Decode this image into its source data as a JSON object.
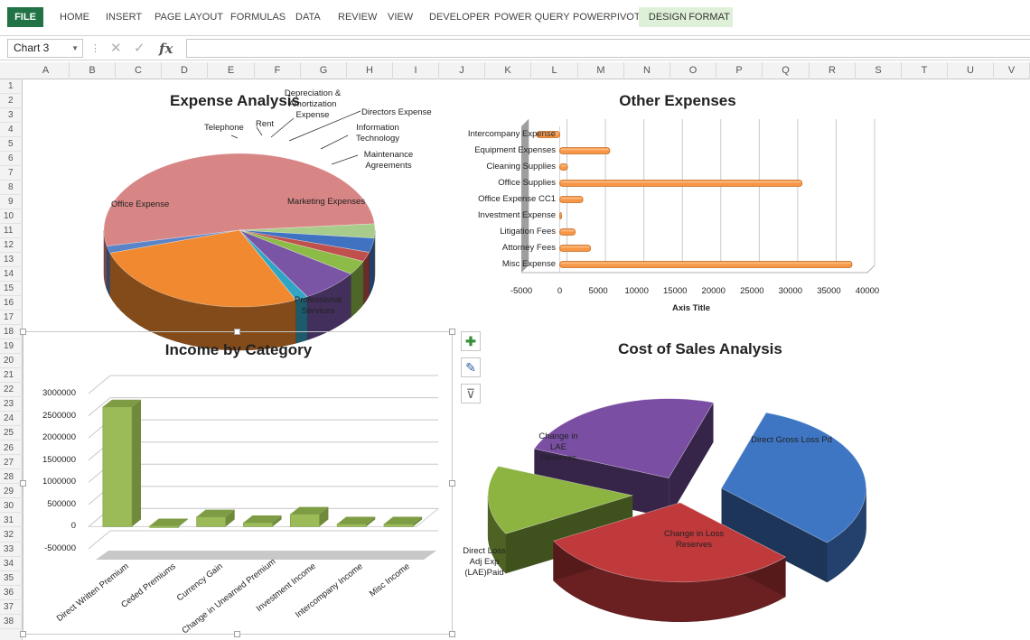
{
  "ribbon": {
    "tabs": [
      "FILE",
      "HOME",
      "INSERT",
      "PAGE LAYOUT",
      "FORMULAS",
      "DATA",
      "REVIEW",
      "VIEW",
      "DEVELOPER",
      "POWER QUERY",
      "POWERPIVOT",
      "DESIGN",
      "FORMAT"
    ]
  },
  "formula_bar": {
    "name_box": "Chart 3",
    "fx": "fx",
    "value": ""
  },
  "sheet": {
    "columns": [
      "A",
      "B",
      "C",
      "D",
      "E",
      "F",
      "G",
      "H",
      "I",
      "J",
      "K",
      "L",
      "M",
      "N",
      "O",
      "P",
      "Q",
      "R",
      "S",
      "T",
      "U",
      "V"
    ],
    "rows": [
      "1",
      "2",
      "3",
      "4",
      "5",
      "6",
      "7",
      "8",
      "9",
      "10",
      "11",
      "12",
      "13",
      "14",
      "15",
      "16",
      "17",
      "18",
      "19",
      "20",
      "21",
      "22",
      "23",
      "24",
      "25",
      "26",
      "27",
      "28",
      "29",
      "30",
      "31",
      "32",
      "33",
      "34",
      "35",
      "36",
      "37",
      "38"
    ]
  },
  "colors": {
    "excel_green": "#217346",
    "bar_orange": "#f79646",
    "bar_green": "#9bbb59"
  },
  "chart_data": [
    {
      "type": "pie",
      "title": "Expense Analysis",
      "categories": [
        "Office Expense",
        "Telephone",
        "Rent",
        "Depreciation & Amortization Expense",
        "Directors Expense",
        "Information Technology",
        "Maintenance Agreements",
        "Marketing Expenses",
        "Professional Services"
      ],
      "values": [
        52,
        3,
        3,
        2,
        3,
        7,
        1.5,
        27,
        1.5
      ]
    },
    {
      "type": "bar",
      "orientation": "horizontal",
      "title": "Other Expenses",
      "xlabel": "Axis Title",
      "categories": [
        "Intercompany Expense",
        "Equipment Expenses",
        "Cleaning Supplies",
        "Office Supplies",
        "Office Expense   CC1",
        "Investment Expense",
        "Litigation Fees",
        "Attorney Fees",
        "Misc Expense"
      ],
      "values": [
        -3000,
        6500,
        1000,
        31500,
        3000,
        200,
        2000,
        4000,
        38000
      ],
      "xlim": [
        -5000,
        40000
      ],
      "xticks": [
        "-5000",
        "0",
        "5000",
        "10000",
        "15000",
        "20000",
        "25000",
        "30000",
        "35000",
        "40000"
      ]
    },
    {
      "type": "bar",
      "title": "Income by Category",
      "categories": [
        "Direct Written Premium",
        "Ceded Premiums",
        "Currency Gain",
        "Change in Unearned Premium",
        "Investment Income",
        "Intercompany Income",
        "Misc Income"
      ],
      "values": [
        2700000,
        20000,
        220000,
        90000,
        280000,
        60000,
        60000
      ],
      "ylim": [
        -500000,
        3000000
      ],
      "yticks": [
        "3000000",
        "2500000",
        "2000000",
        "1500000",
        "1000000",
        "500000",
        "0",
        "-500000"
      ]
    },
    {
      "type": "pie",
      "title": "Cost of Sales Analysis",
      "categories": [
        "Direct Gross Loss Pd",
        "Change in Loss Reserves",
        "Direct Loss Adj Exp (LAE)Paid",
        "Change in LAE Reserves"
      ],
      "values": [
        32,
        30,
        14,
        24
      ]
    }
  ]
}
